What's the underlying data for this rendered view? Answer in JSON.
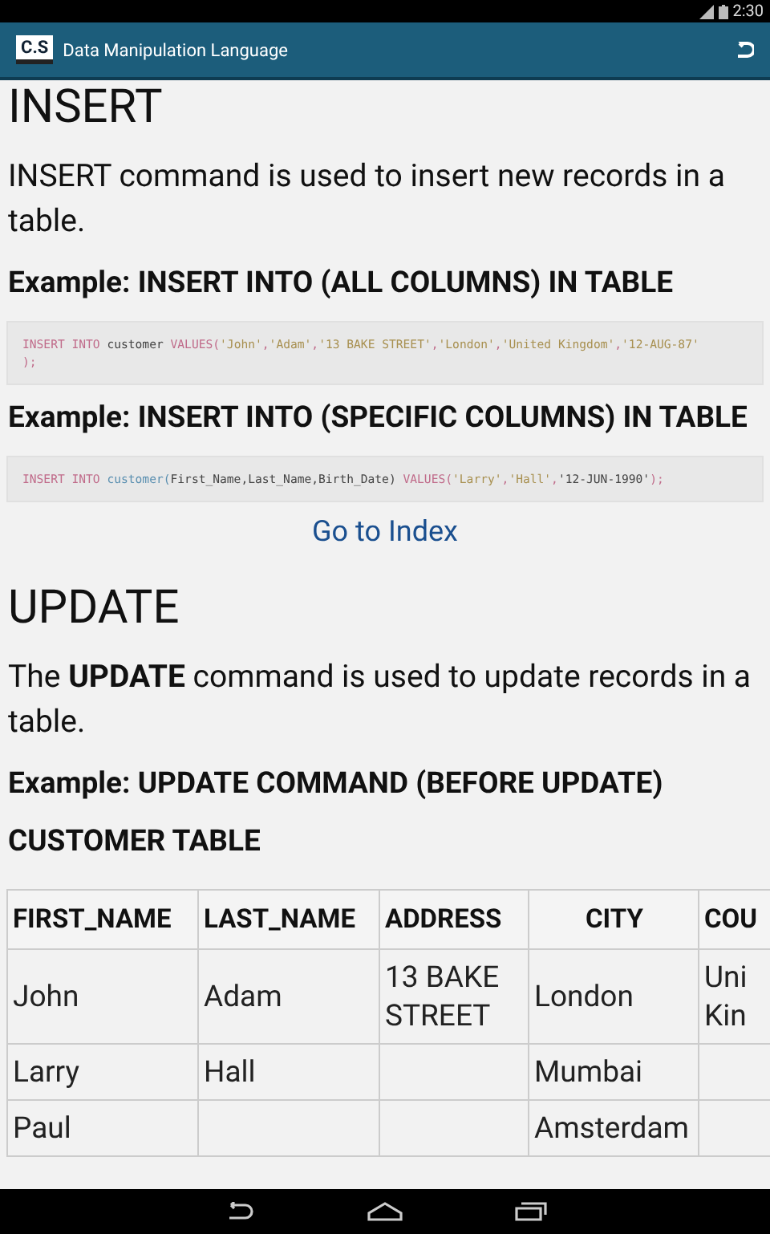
{
  "status_bar": {
    "time": "2:30"
  },
  "app_bar": {
    "logo": "C.S",
    "title": "Data Manipulation Language"
  },
  "sections": [
    {
      "kind": "heading",
      "text": "INSERT"
    },
    {
      "kind": "paragraph",
      "text": "INSERT command is used to insert new records in a table."
    },
    {
      "kind": "subheading",
      "text": "Example: INSERT INTO (ALL COLUMNS) IN TABLE"
    },
    {
      "kind": "code",
      "lines": [
        [
          {
            "kind": "keyword",
            "text": "INSERT INTO "
          },
          {
            "kind": "plain",
            "text": "customer "
          },
          {
            "kind": "keyword",
            "text": "VALUES("
          },
          {
            "kind": "string",
            "text": "'John'"
          },
          {
            "kind": "punct",
            "text": ","
          },
          {
            "kind": "string",
            "text": "'Adam'"
          },
          {
            "kind": "punct",
            "text": ","
          },
          {
            "kind": "string",
            "text": "'13 BAKE STREET'"
          },
          {
            "kind": "punct",
            "text": ","
          },
          {
            "kind": "string",
            "text": "'London'"
          },
          {
            "kind": "punct",
            "text": ","
          },
          {
            "kind": "string",
            "text": "'United Kingdom'"
          },
          {
            "kind": "punct",
            "text": ","
          },
          {
            "kind": "string",
            "text": "'12-AUG-87'"
          }
        ],
        [
          {
            "kind": "punct",
            "text": ");"
          }
        ]
      ]
    },
    {
      "kind": "subheading",
      "text": "Example: INSERT INTO (SPECIFIC COLUMNS) IN TABLE"
    },
    {
      "kind": "code",
      "lines": [
        [
          {
            "kind": "keyword",
            "text": "INSERT INTO "
          },
          {
            "kind": "name",
            "text": "customer("
          },
          {
            "kind": "plain",
            "text": "First_Name,Last_Name,Birth_Date) "
          },
          {
            "kind": "keyword",
            "text": "VALUES("
          },
          {
            "kind": "string",
            "text": "'Larry'"
          },
          {
            "kind": "punct",
            "text": ","
          },
          {
            "kind": "string",
            "text": "'Hall'"
          },
          {
            "kind": "punct",
            "text": ","
          },
          {
            "kind": "plain",
            "text": "'12-JUN-1990'"
          },
          {
            "kind": "punct",
            "text": ");"
          }
        ]
      ]
    },
    {
      "kind": "link",
      "text": "Go to Index"
    },
    {
      "kind": "heading",
      "text": "UPDATE"
    },
    {
      "kind": "paragraph",
      "text": "The **UPDATE** command is used to update records in a table."
    },
    {
      "kind": "subheading",
      "text": "Example: UPDATE COMMAND (BEFORE UPDATE)"
    },
    {
      "kind": "subheading",
      "text": "CUSTOMER TABLE"
    },
    {
      "kind": "table",
      "columns": [
        "FIRST_NAME",
        "LAST_NAME",
        "ADDRESS",
        "CITY",
        "COU"
      ],
      "rows": [
        [
          "John",
          "Adam",
          "13 BAKE STREET",
          "London",
          "Uni Kin"
        ],
        [
          "Larry",
          "Hall",
          "",
          "Mumbai",
          ""
        ],
        [
          "Paul",
          "",
          "",
          "Amsterdam",
          ""
        ]
      ]
    }
  ]
}
